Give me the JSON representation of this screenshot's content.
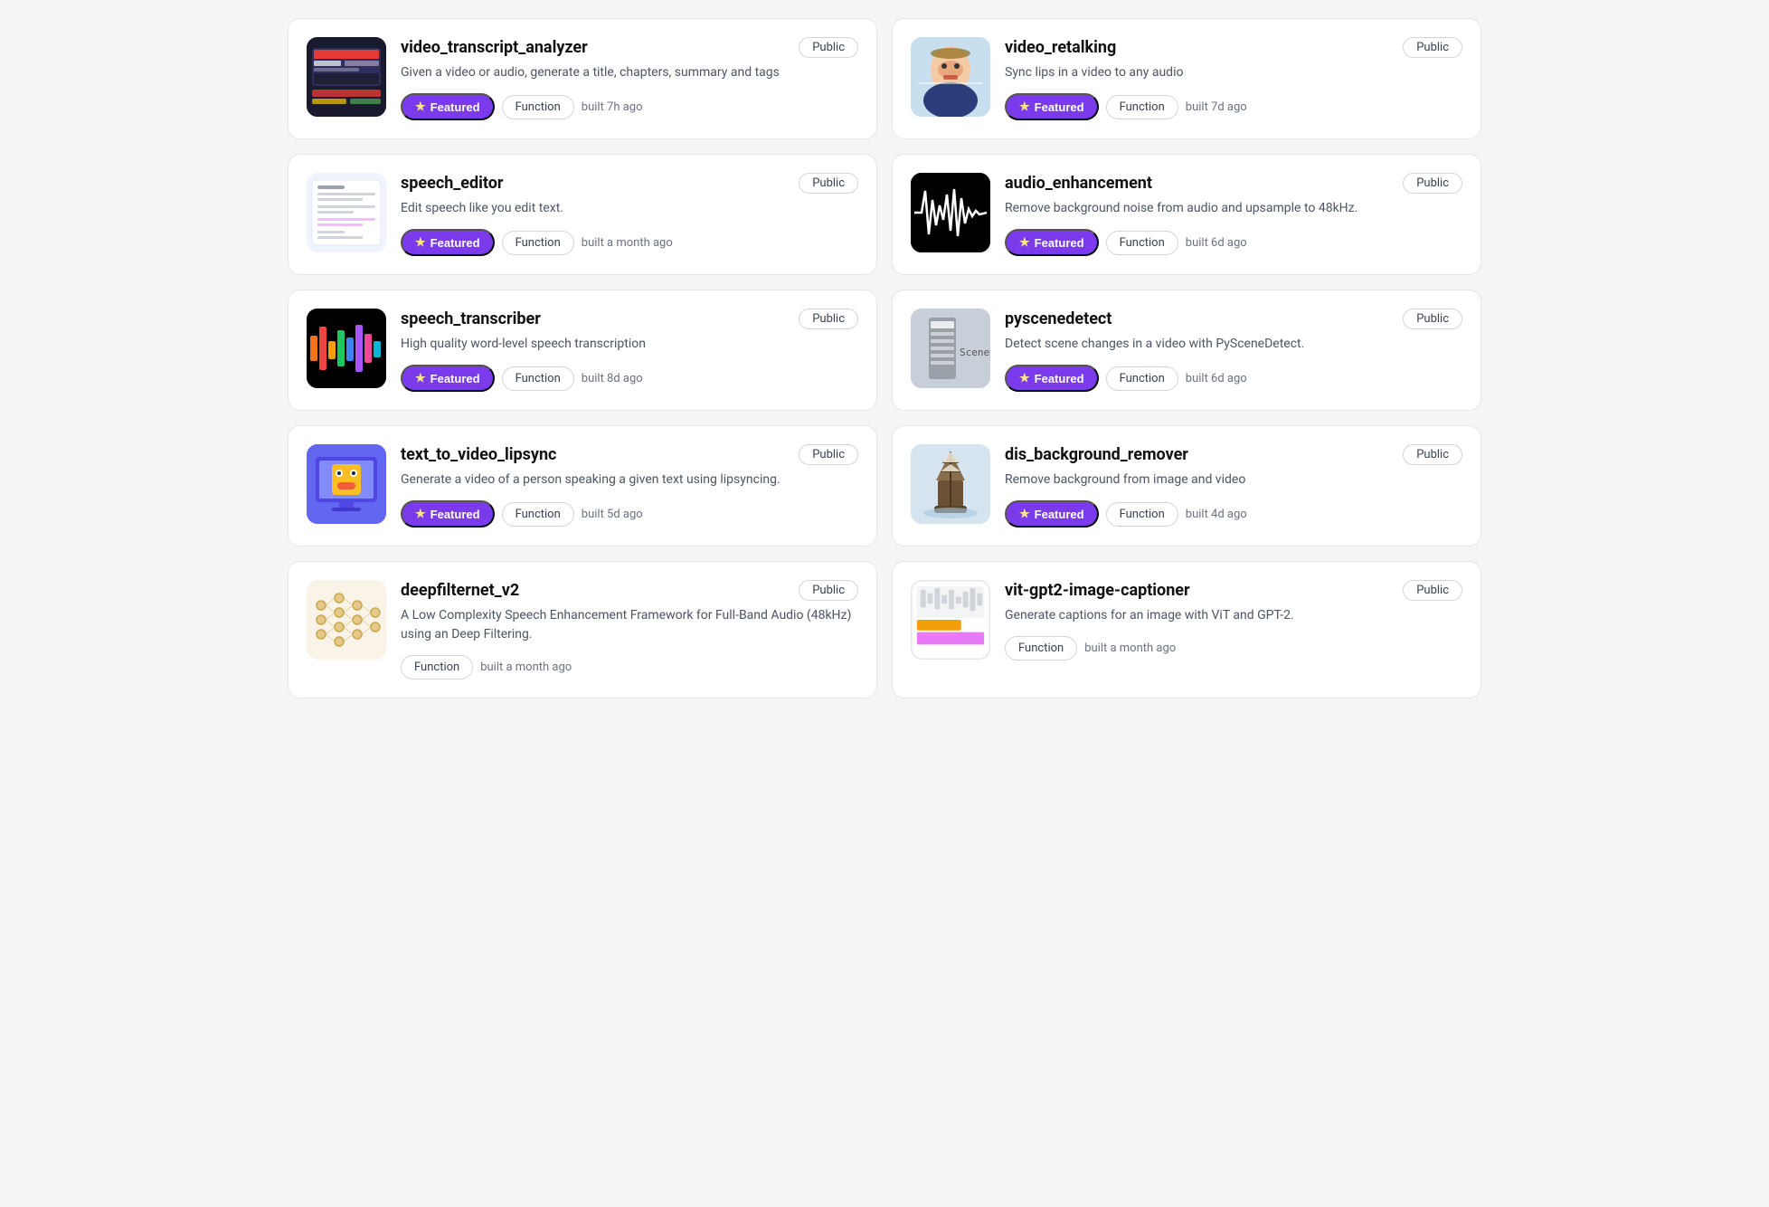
{
  "cards": [
    {
      "id": "video-transcript-analyzer",
      "title": "video_transcript_analyzer",
      "description": "Given a video or audio, generate a title, chapters, summary and tags",
      "visibility": "Public",
      "featured": true,
      "tag": "Function",
      "time": "built 7h ago",
      "thumb_type": "video-transcript"
    },
    {
      "id": "video-retalking",
      "title": "video_retalking",
      "description": "Sync lips in a video to any audio",
      "visibility": "Public",
      "featured": true,
      "tag": "Function",
      "time": "built 7d ago",
      "thumb_type": "video-retalking"
    },
    {
      "id": "speech-editor",
      "title": "speech_editor",
      "description": "Edit speech like you edit text.",
      "visibility": "Public",
      "featured": true,
      "tag": "Function",
      "time": "built a month ago",
      "thumb_type": "speech-editor"
    },
    {
      "id": "audio-enhancement",
      "title": "audio_enhancement",
      "description": "Remove background noise from audio and upsample to 48kHz.",
      "visibility": "Public",
      "featured": true,
      "tag": "Function",
      "time": "built 6d ago",
      "thumb_type": "audio-enhancement"
    },
    {
      "id": "speech-transcriber",
      "title": "speech_transcriber",
      "description": "High quality word-level speech transcription",
      "visibility": "Public",
      "featured": true,
      "tag": "Function",
      "time": "built 8d ago",
      "thumb_type": "speech-transcriber"
    },
    {
      "id": "pyscenedetect",
      "title": "pyscenedetect",
      "description": "Detect scene changes in a video with PySceneDetect.",
      "visibility": "Public",
      "featured": true,
      "tag": "Function",
      "time": "built 6d ago",
      "thumb_type": "pyscene"
    },
    {
      "id": "text-to-video-lipsync",
      "title": "text_to_video_lipsync",
      "description": "Generate a video of a person speaking a given text using lipsyncing.",
      "visibility": "Public",
      "featured": true,
      "tag": "Function",
      "time": "built 5d ago",
      "thumb_type": "text-video"
    },
    {
      "id": "dis-background-remover",
      "title": "dis_background_remover",
      "description": "Remove background from image and video",
      "visibility": "Public",
      "featured": true,
      "tag": "Function",
      "time": "built 4d ago",
      "thumb_type": "dis-bg"
    },
    {
      "id": "deepfilternet-v2",
      "title": "deepfilternet_v2",
      "description": "A Low Complexity Speech Enhancement Framework for Full-Band Audio (48kHz) using an Deep Filtering.",
      "visibility": "Public",
      "featured": false,
      "tag": "Function",
      "time": "built a month ago",
      "thumb_type": "deepfilter"
    },
    {
      "id": "vit-gpt2-image-captioner",
      "title": "vit-gpt2-image-captioner",
      "description": "Generate captions for an image with ViT and GPT-2.",
      "visibility": "Public",
      "featured": false,
      "tag": "Function",
      "time": "built a month ago",
      "thumb_type": "vit-gpt2"
    }
  ],
  "labels": {
    "featured": "Featured",
    "public": "Public",
    "function": "Function",
    "star": "★"
  }
}
